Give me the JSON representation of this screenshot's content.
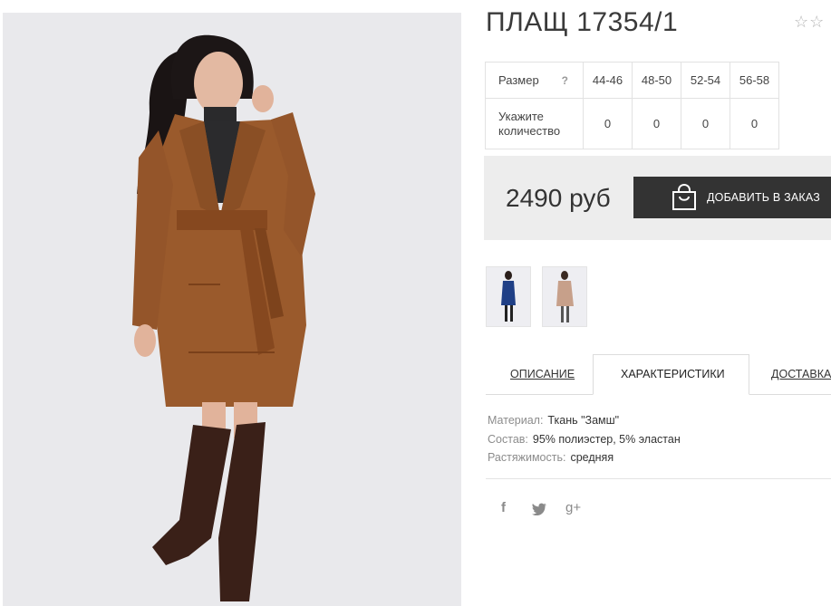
{
  "product": {
    "title": "ПЛАЩ 17354/1",
    "rating_stars": "☆☆"
  },
  "size_table": {
    "size_label": "Размер",
    "help": "?",
    "sizes": [
      "44-46",
      "48-50",
      "52-54",
      "56-58"
    ],
    "qty_label": "Укажите количество",
    "quantities": [
      "0",
      "0",
      "0",
      "0"
    ]
  },
  "buy": {
    "price": "2490 руб",
    "add_button": "ДОБАВИТЬ В ЗАКАЗ"
  },
  "tabs": {
    "description": "ОПИСАНИЕ",
    "characteristics": "ХАРАКТЕРИСТИКИ",
    "delivery": "ДОСТАВКА"
  },
  "specs": [
    {
      "key": "Материал:",
      "value": "Ткань \"Замш\""
    },
    {
      "key": "Состав:",
      "value": "95% полиэстер, 5% эластан"
    },
    {
      "key": "Растяжимость:",
      "value": "средняя"
    }
  ],
  "social": {
    "facebook": "f",
    "twitter": "🐦",
    "googleplus": "g+"
  },
  "colors": {
    "coat_main": "#9a5a2c",
    "boots": "#3a2018",
    "thumb1_coat": "#1f3f86",
    "thumb2_coat": "#c7a08a",
    "button_bg": "#333333",
    "buybox_bg": "#ededed"
  }
}
